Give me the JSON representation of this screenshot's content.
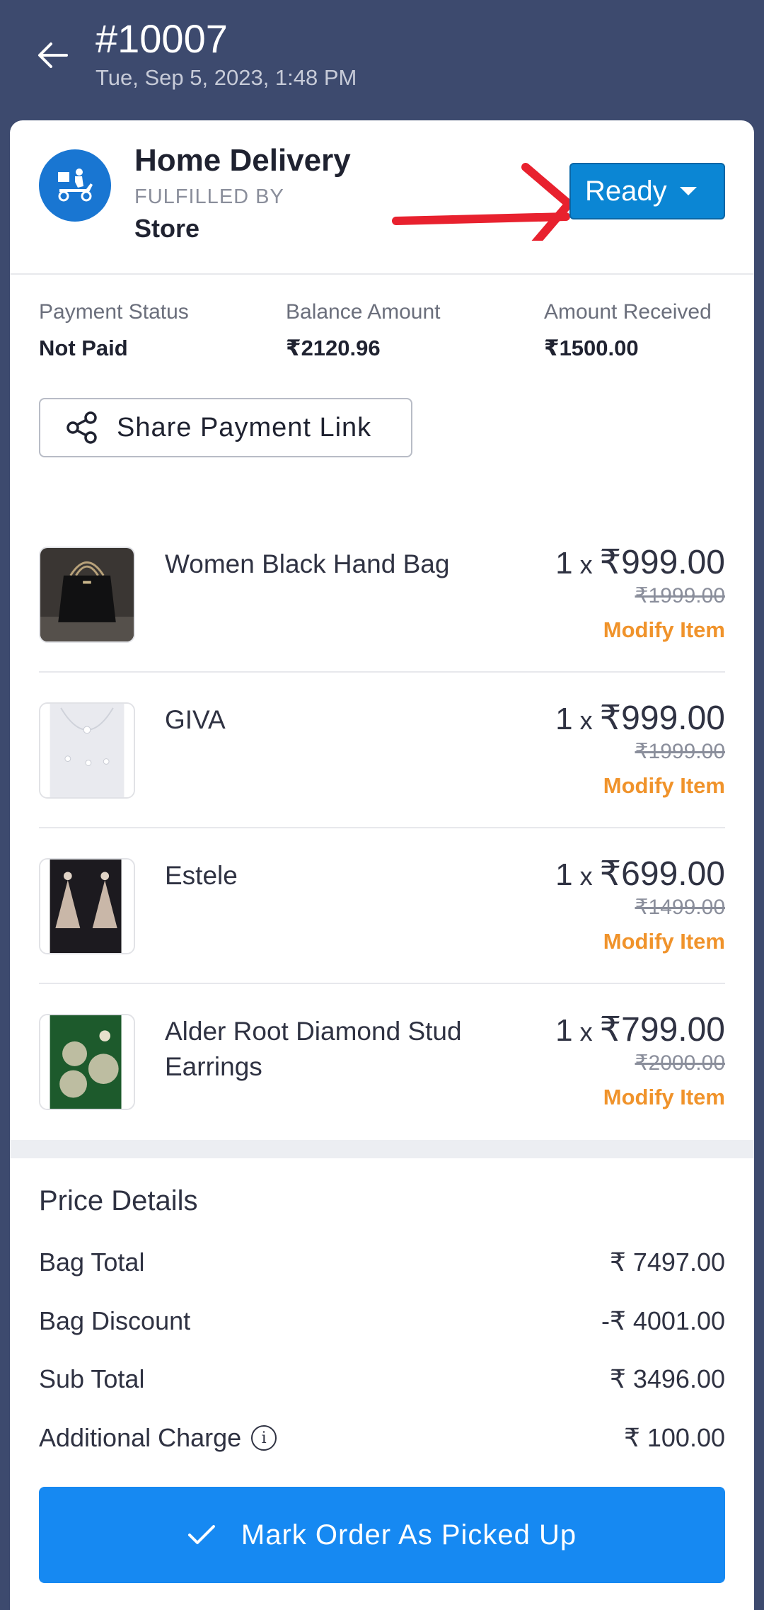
{
  "header": {
    "order_id": "#10007",
    "order_date": "Tue, Sep 5, 2023, 1:48 PM"
  },
  "delivery": {
    "title": "Home Delivery",
    "fulfilled_label": "FULFILLED BY",
    "fulfilled_value": "Store",
    "icon": "scooter-delivery-icon",
    "status": "Ready"
  },
  "payment": {
    "status_label": "Payment Status",
    "status_value": "Not Paid",
    "balance_label": "Balance Amount",
    "balance_value": "₹2120.96",
    "received_label": "Amount Received",
    "received_value": "₹1500.00",
    "share_label": "Share Payment Link"
  },
  "items": [
    {
      "name": "Women Black Hand Bag",
      "qty": "1",
      "x": "x",
      "price": "₹999.00",
      "mrp": "₹1999.00",
      "action": "Modify Item"
    },
    {
      "name": "GIVA",
      "qty": "1",
      "x": "x",
      "price": "₹999.00",
      "mrp": "₹1999.00",
      "action": "Modify Item"
    },
    {
      "name": "Estele",
      "qty": "1",
      "x": "x",
      "price": "₹699.00",
      "mrp": "₹1499.00",
      "action": "Modify Item"
    },
    {
      "name": "Alder Root Diamond Stud Earrings",
      "qty": "1",
      "x": "x",
      "price": "₹799.00",
      "mrp": "₹2000.00",
      "action": "Modify Item"
    }
  ],
  "price_details": {
    "title": "Price Details",
    "rows": [
      {
        "label": "Bag Total",
        "value": "₹ 7497.00"
      },
      {
        "label": "Bag Discount",
        "value": "-₹ 4001.00"
      },
      {
        "label": "Sub Total",
        "value": "₹ 3496.00"
      },
      {
        "label": "Additional Charge",
        "value": "₹ 100.00"
      }
    ]
  },
  "actions": {
    "mark_picked_up": "Mark Order As Picked Up"
  },
  "colors": {
    "header_bg": "#3d4a6e",
    "status_btn": "#0b86d4",
    "primary_btn": "#1689f2",
    "modify_link": "#f0932b",
    "annotation_arrow": "#e8212e"
  }
}
